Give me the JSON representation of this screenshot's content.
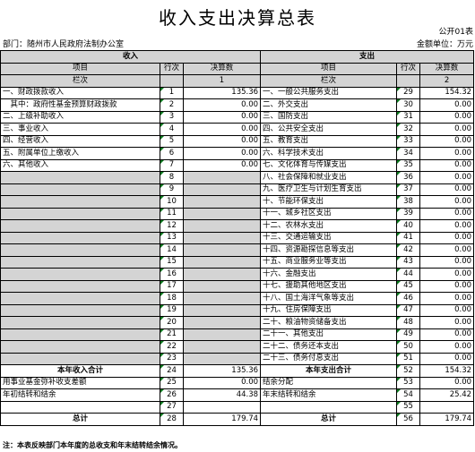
{
  "title": "收入支出决算总表",
  "form_no": "公开01表",
  "department": "部门：随州市人民政府法制办公室",
  "unit": "金额单位：万元",
  "income_header": "收入",
  "expense_header": "支出",
  "col_item": "项目",
  "col_seq": "行次",
  "col_amount": "决算数",
  "col_lanci": "栏次",
  "income_col_no": "1",
  "expense_col_no": "2",
  "rows": [
    {
      "in_label": "一、财政拨款收入",
      "in_seq": "1",
      "in_amt": "135.36",
      "ex_label": "一、一般公共服务支出",
      "ex_seq": "29",
      "ex_amt": "154.32"
    },
    {
      "in_label": "　其中：政府性基金预算财政拨款",
      "in_seq": "2",
      "in_amt": "0.00",
      "ex_label": "二、外交支出",
      "ex_seq": "30",
      "ex_amt": "0.00"
    },
    {
      "in_label": "二、上级补助收入",
      "in_seq": "3",
      "in_amt": "0.00",
      "ex_label": "三、国防支出",
      "ex_seq": "31",
      "ex_amt": "0.00"
    },
    {
      "in_label": "三、事业收入",
      "in_seq": "4",
      "in_amt": "0.00",
      "ex_label": "四、公共安全支出",
      "ex_seq": "32",
      "ex_amt": "0.00"
    },
    {
      "in_label": "四、经营收入",
      "in_seq": "5",
      "in_amt": "0.00",
      "ex_label": "五、教育支出",
      "ex_seq": "33",
      "ex_amt": "0.00"
    },
    {
      "in_label": "五、附属单位上缴收入",
      "in_seq": "6",
      "in_amt": "0.00",
      "ex_label": "六、科学技术支出",
      "ex_seq": "34",
      "ex_amt": "0.00"
    },
    {
      "in_label": "六、其他收入",
      "in_seq": "7",
      "in_amt": "0.00",
      "ex_label": "七、文化体育与传媒支出",
      "ex_seq": "35",
      "ex_amt": "0.00"
    },
    {
      "in_label": "",
      "in_seq": "8",
      "in_amt": "",
      "ex_label": "八、社会保障和就业支出",
      "ex_seq": "36",
      "ex_amt": "0.00"
    },
    {
      "in_label": "",
      "in_seq": "9",
      "in_amt": "",
      "ex_label": "九、医疗卫生与计划生育支出",
      "ex_seq": "37",
      "ex_amt": "0.00"
    },
    {
      "in_label": "",
      "in_seq": "10",
      "in_amt": "",
      "ex_label": "十、节能环保支出",
      "ex_seq": "38",
      "ex_amt": "0.00"
    },
    {
      "in_label": "",
      "in_seq": "11",
      "in_amt": "",
      "ex_label": "十一、城乡社区支出",
      "ex_seq": "39",
      "ex_amt": "0.00"
    },
    {
      "in_label": "",
      "in_seq": "12",
      "in_amt": "",
      "ex_label": "十二、农林水支出",
      "ex_seq": "40",
      "ex_amt": "0.00"
    },
    {
      "in_label": "",
      "in_seq": "13",
      "in_amt": "",
      "ex_label": "十三、交通运输支出",
      "ex_seq": "41",
      "ex_amt": "0.00"
    },
    {
      "in_label": "",
      "in_seq": "14",
      "in_amt": "",
      "ex_label": "十四、资源勘探信息等支出",
      "ex_seq": "42",
      "ex_amt": "0.00"
    },
    {
      "in_label": "",
      "in_seq": "15",
      "in_amt": "",
      "ex_label": "十五、商业服务业等支出",
      "ex_seq": "43",
      "ex_amt": "0.00"
    },
    {
      "in_label": "",
      "in_seq": "16",
      "in_amt": "",
      "ex_label": "十六、金融支出",
      "ex_seq": "44",
      "ex_amt": "0.00"
    },
    {
      "in_label": "",
      "in_seq": "17",
      "in_amt": "",
      "ex_label": "十七、援助其他地区支出",
      "ex_seq": "45",
      "ex_amt": "0.00"
    },
    {
      "in_label": "",
      "in_seq": "18",
      "in_amt": "",
      "ex_label": "十八、国土海洋气象等支出",
      "ex_seq": "46",
      "ex_amt": "0.00"
    },
    {
      "in_label": "",
      "in_seq": "19",
      "in_amt": "",
      "ex_label": "十九、住房保障支出",
      "ex_seq": "47",
      "ex_amt": "0.00"
    },
    {
      "in_label": "",
      "in_seq": "20",
      "in_amt": "",
      "ex_label": "二十、粮油物资储备支出",
      "ex_seq": "48",
      "ex_amt": "0.00"
    },
    {
      "in_label": "",
      "in_seq": "21",
      "in_amt": "",
      "ex_label": "二十一、其他支出",
      "ex_seq": "49",
      "ex_amt": "0.00"
    },
    {
      "in_label": "",
      "in_seq": "22",
      "in_amt": "",
      "ex_label": "二十二、债务还本支出",
      "ex_seq": "50",
      "ex_amt": "0.00"
    },
    {
      "in_label": "",
      "in_seq": "23",
      "in_amt": "",
      "ex_label": "二十三、债务付息支出",
      "ex_seq": "51",
      "ex_amt": "0.00"
    }
  ],
  "totals": [
    {
      "in_label": "本年收入合计",
      "in_seq": "24",
      "in_amt": "135.36",
      "ex_label": "本年支出合计",
      "ex_seq": "52",
      "ex_amt": "154.32"
    },
    {
      "in_label": "用事业基金弥补收支差额",
      "in_seq": "25",
      "in_amt": "0.00",
      "ex_label": "结余分配",
      "ex_seq": "53",
      "ex_amt": "0.00"
    },
    {
      "in_label": "年初结转和结余",
      "in_seq": "26",
      "in_amt": "44.38",
      "ex_label": "年末结转和结余",
      "ex_seq": "54",
      "ex_amt": "25.42"
    },
    {
      "in_label": "",
      "in_seq": "27",
      "in_amt": "",
      "ex_label": "",
      "ex_seq": "55",
      "ex_amt": ""
    },
    {
      "in_label": "总计",
      "in_seq": "28",
      "in_amt": "179.74",
      "ex_label": "总计",
      "ex_seq": "56",
      "ex_amt": "179.74"
    }
  ],
  "note": "注：本表反映部门本年度的总收支和年末结转结余情况。"
}
